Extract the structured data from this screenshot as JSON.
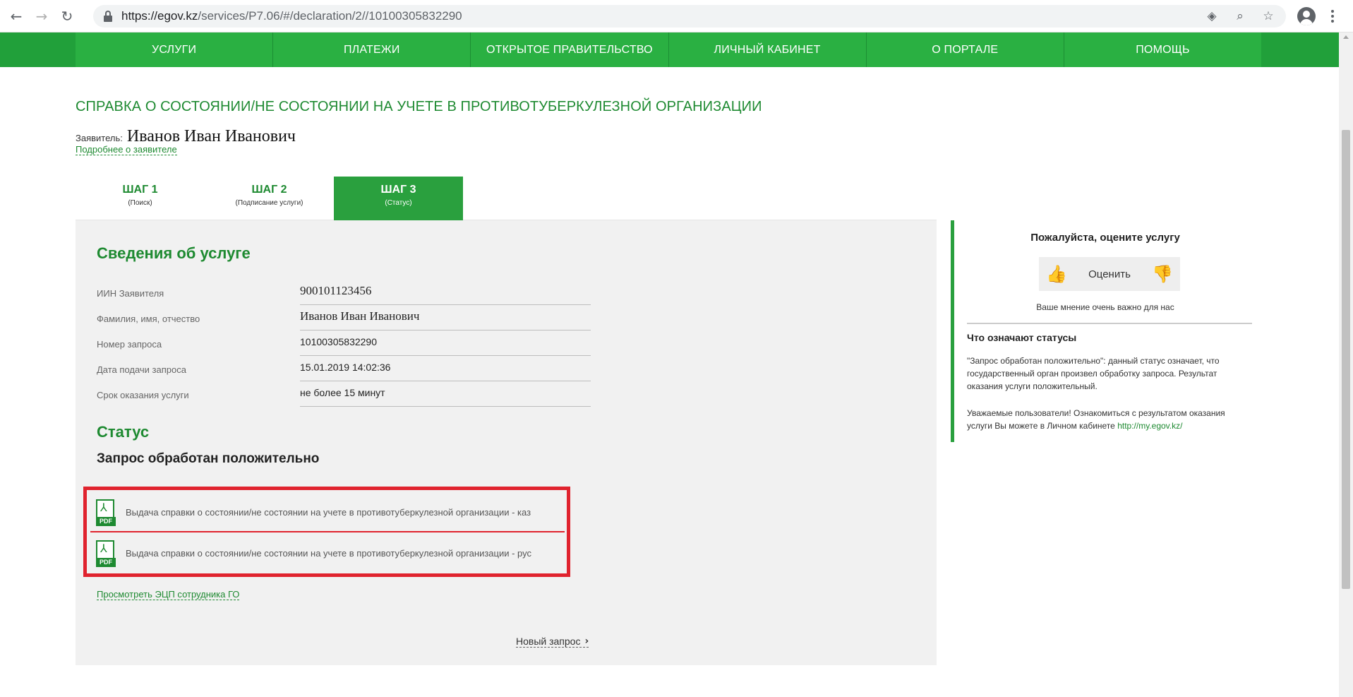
{
  "browser": {
    "url_host": "https://egov.kz",
    "url_path": "/services/P7.06/#/declaration/2//10100305832290"
  },
  "nav": {
    "items": [
      "УСЛУГИ",
      "ПЛАТЕЖИ",
      "ОТКРЫТОЕ ПРАВИТЕЛЬСТВО",
      "ЛИЧНЫЙ КАБИНЕТ",
      "О ПОРТАЛЕ",
      "ПОМОЩЬ"
    ]
  },
  "page": {
    "title": "СПРАВКА О СОСТОЯНИИ/НЕ СОСТОЯНИИ НА УЧЕТЕ В ПРОТИВОТУБЕРКУЛЕЗНОЙ ОРГАНИЗАЦИИ",
    "applicant_label": "Заявитель:",
    "applicant_name": "Иванов Иван Иванович",
    "applicant_link": "Подробнее о заявителе"
  },
  "steps": [
    {
      "title": "ШАГ 1",
      "sub": "(Поиск)"
    },
    {
      "title": "ШАГ 2",
      "sub": "(Подписание услуги)"
    },
    {
      "title": "ШАГ 3",
      "sub": "(Статус)"
    }
  ],
  "service": {
    "section_title": "Сведения об услуге",
    "rows": [
      {
        "label": "ИИН Заявителя",
        "value": "900101123456"
      },
      {
        "label": "Фамилия, имя, отчество",
        "value": "Иванов Иван Иванович"
      },
      {
        "label": "Номер запроса",
        "value": "10100305832290"
      },
      {
        "label": "Дата подачи запроса",
        "value": "15.01.2019 14:02:36"
      },
      {
        "label": "Срок оказания услуги",
        "value": "не более 15 минут"
      }
    ]
  },
  "status": {
    "section_title": "Статус",
    "text": "Запрос обработан положительно",
    "documents": [
      {
        "label": "Выдача справки о состоянии/не состоянии на учете в противотуберкулезной организации - каз",
        "icon": "pdf-icon",
        "icon_label": "PDF"
      },
      {
        "label": "Выдача справки о состоянии/не состоянии на учете в противотуберкулезной организации - рус",
        "icon": "pdf-icon",
        "icon_label": "PDF"
      }
    ],
    "ecp_link": "Просмотреть ЭЦП сотрудника ГО",
    "new_request": "Новый запрос"
  },
  "sidebar": {
    "rate_title": "Пожалуйста, оцените услугу",
    "rate_label": "Оценить",
    "rate_note": "Ваше мнение очень важно для нас",
    "status_head": "Что означают статусы",
    "status_desc": "\"Запрос обработан положительно\": данный статус означает, что государственный орган произвел обработку запроса. Результат оказания услуги положительный.",
    "status_note": "Уважаемые пользователи! Ознакомиться с результатом оказания услуги Вы можете в Личном кабинете",
    "portal_link": "http://my.egov.kz/"
  },
  "colors": {
    "brand_green": "#2ab042",
    "highlight_red": "#e0232e"
  }
}
